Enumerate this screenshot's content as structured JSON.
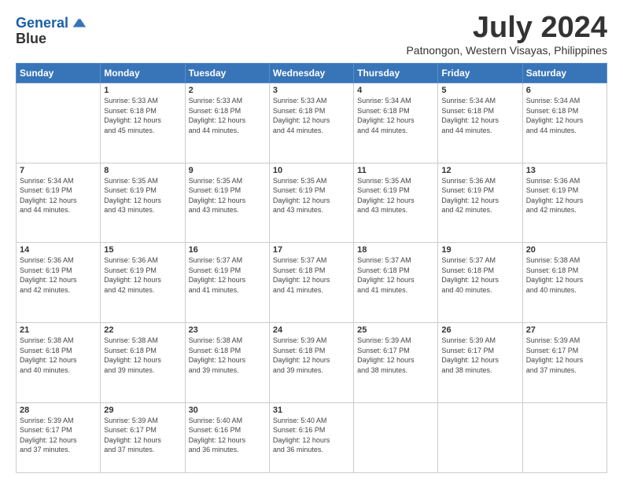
{
  "logo": {
    "line1": "General",
    "line2": "Blue"
  },
  "title": "July 2024",
  "location": "Patnongon, Western Visayas, Philippines",
  "headers": [
    "Sunday",
    "Monday",
    "Tuesday",
    "Wednesday",
    "Thursday",
    "Friday",
    "Saturday"
  ],
  "weeks": [
    [
      {
        "day": "",
        "info": ""
      },
      {
        "day": "1",
        "info": "Sunrise: 5:33 AM\nSunset: 6:18 PM\nDaylight: 12 hours\nand 45 minutes."
      },
      {
        "day": "2",
        "info": "Sunrise: 5:33 AM\nSunset: 6:18 PM\nDaylight: 12 hours\nand 44 minutes."
      },
      {
        "day": "3",
        "info": "Sunrise: 5:33 AM\nSunset: 6:18 PM\nDaylight: 12 hours\nand 44 minutes."
      },
      {
        "day": "4",
        "info": "Sunrise: 5:34 AM\nSunset: 6:18 PM\nDaylight: 12 hours\nand 44 minutes."
      },
      {
        "day": "5",
        "info": "Sunrise: 5:34 AM\nSunset: 6:18 PM\nDaylight: 12 hours\nand 44 minutes."
      },
      {
        "day": "6",
        "info": "Sunrise: 5:34 AM\nSunset: 6:18 PM\nDaylight: 12 hours\nand 44 minutes."
      }
    ],
    [
      {
        "day": "7",
        "info": "Sunrise: 5:34 AM\nSunset: 6:19 PM\nDaylight: 12 hours\nand 44 minutes."
      },
      {
        "day": "8",
        "info": "Sunrise: 5:35 AM\nSunset: 6:19 PM\nDaylight: 12 hours\nand 43 minutes."
      },
      {
        "day": "9",
        "info": "Sunrise: 5:35 AM\nSunset: 6:19 PM\nDaylight: 12 hours\nand 43 minutes."
      },
      {
        "day": "10",
        "info": "Sunrise: 5:35 AM\nSunset: 6:19 PM\nDaylight: 12 hours\nand 43 minutes."
      },
      {
        "day": "11",
        "info": "Sunrise: 5:35 AM\nSunset: 6:19 PM\nDaylight: 12 hours\nand 43 minutes."
      },
      {
        "day": "12",
        "info": "Sunrise: 5:36 AM\nSunset: 6:19 PM\nDaylight: 12 hours\nand 42 minutes."
      },
      {
        "day": "13",
        "info": "Sunrise: 5:36 AM\nSunset: 6:19 PM\nDaylight: 12 hours\nand 42 minutes."
      }
    ],
    [
      {
        "day": "14",
        "info": "Sunrise: 5:36 AM\nSunset: 6:19 PM\nDaylight: 12 hours\nand 42 minutes."
      },
      {
        "day": "15",
        "info": "Sunrise: 5:36 AM\nSunset: 6:19 PM\nDaylight: 12 hours\nand 42 minutes."
      },
      {
        "day": "16",
        "info": "Sunrise: 5:37 AM\nSunset: 6:19 PM\nDaylight: 12 hours\nand 41 minutes."
      },
      {
        "day": "17",
        "info": "Sunrise: 5:37 AM\nSunset: 6:18 PM\nDaylight: 12 hours\nand 41 minutes."
      },
      {
        "day": "18",
        "info": "Sunrise: 5:37 AM\nSunset: 6:18 PM\nDaylight: 12 hours\nand 41 minutes."
      },
      {
        "day": "19",
        "info": "Sunrise: 5:37 AM\nSunset: 6:18 PM\nDaylight: 12 hours\nand 40 minutes."
      },
      {
        "day": "20",
        "info": "Sunrise: 5:38 AM\nSunset: 6:18 PM\nDaylight: 12 hours\nand 40 minutes."
      }
    ],
    [
      {
        "day": "21",
        "info": "Sunrise: 5:38 AM\nSunset: 6:18 PM\nDaylight: 12 hours\nand 40 minutes."
      },
      {
        "day": "22",
        "info": "Sunrise: 5:38 AM\nSunset: 6:18 PM\nDaylight: 12 hours\nand 39 minutes."
      },
      {
        "day": "23",
        "info": "Sunrise: 5:38 AM\nSunset: 6:18 PM\nDaylight: 12 hours\nand 39 minutes."
      },
      {
        "day": "24",
        "info": "Sunrise: 5:39 AM\nSunset: 6:18 PM\nDaylight: 12 hours\nand 39 minutes."
      },
      {
        "day": "25",
        "info": "Sunrise: 5:39 AM\nSunset: 6:17 PM\nDaylight: 12 hours\nand 38 minutes."
      },
      {
        "day": "26",
        "info": "Sunrise: 5:39 AM\nSunset: 6:17 PM\nDaylight: 12 hours\nand 38 minutes."
      },
      {
        "day": "27",
        "info": "Sunrise: 5:39 AM\nSunset: 6:17 PM\nDaylight: 12 hours\nand 37 minutes."
      }
    ],
    [
      {
        "day": "28",
        "info": "Sunrise: 5:39 AM\nSunset: 6:17 PM\nDaylight: 12 hours\nand 37 minutes."
      },
      {
        "day": "29",
        "info": "Sunrise: 5:39 AM\nSunset: 6:17 PM\nDaylight: 12 hours\nand 37 minutes."
      },
      {
        "day": "30",
        "info": "Sunrise: 5:40 AM\nSunset: 6:16 PM\nDaylight: 12 hours\nand 36 minutes."
      },
      {
        "day": "31",
        "info": "Sunrise: 5:40 AM\nSunset: 6:16 PM\nDaylight: 12 hours\nand 36 minutes."
      },
      {
        "day": "",
        "info": ""
      },
      {
        "day": "",
        "info": ""
      },
      {
        "day": "",
        "info": ""
      }
    ]
  ]
}
